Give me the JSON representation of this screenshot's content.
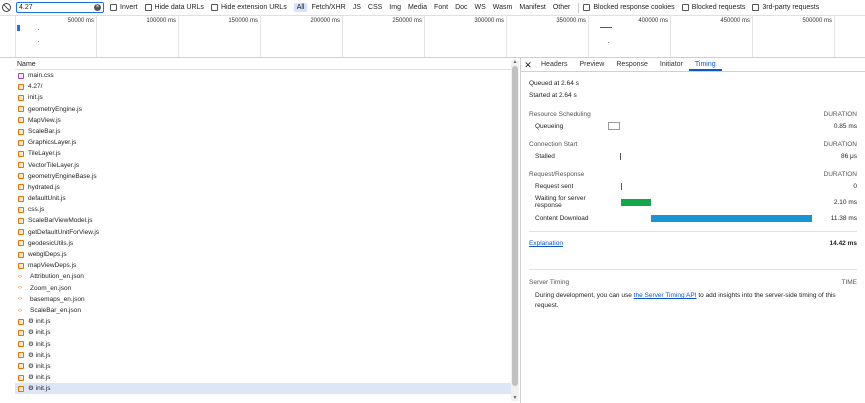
{
  "filter": {
    "value": "4.27",
    "invert_label": "Invert",
    "hide_data_urls_label": "Hide data URLs",
    "hide_extension_urls_label": "Hide extension URLs",
    "types": [
      "All",
      "Fetch/XHR",
      "JS",
      "CSS",
      "Img",
      "Media",
      "Font",
      "Doc",
      "WS",
      "Wasm",
      "Manifest",
      "Other"
    ],
    "blocked_cookies_label": "Blocked response cookies",
    "blocked_requests_label": "Blocked requests",
    "third_party_label": "3rd-party requests"
  },
  "overview": {
    "ticks": [
      "50000 ms",
      "100000 ms",
      "150000 ms",
      "200000 ms",
      "250000 ms",
      "300000 ms",
      "350000 ms",
      "400000 ms",
      "450000 ms",
      "500000 ms"
    ]
  },
  "list": {
    "header": "Name",
    "rows": [
      {
        "name": "main.css",
        "kind": "css"
      },
      {
        "name": "4.27/",
        "kind": "doc"
      },
      {
        "name": "init.js",
        "kind": "js"
      },
      {
        "name": "geometryEngine.js",
        "kind": "js"
      },
      {
        "name": "MapView.js",
        "kind": "js"
      },
      {
        "name": "ScaleBar.js",
        "kind": "js"
      },
      {
        "name": "GraphicsLayer.js",
        "kind": "js"
      },
      {
        "name": "TileLayer.js",
        "kind": "js"
      },
      {
        "name": "VectorTileLayer.js",
        "kind": "js"
      },
      {
        "name": "geometryEngineBase.js",
        "kind": "js"
      },
      {
        "name": "hydrated.js",
        "kind": "js"
      },
      {
        "name": "defaultUnit.js",
        "kind": "js"
      },
      {
        "name": "css.js",
        "kind": "js"
      },
      {
        "name": "ScaleBarViewModel.js",
        "kind": "js"
      },
      {
        "name": "getDefaultUnitForView.js",
        "kind": "js"
      },
      {
        "name": "geodesicUtils.js",
        "kind": "js"
      },
      {
        "name": "webglDeps.js",
        "kind": "js"
      },
      {
        "name": "mapViewDeps.js",
        "kind": "js"
      },
      {
        "name": "Attribution_en.json",
        "kind": "json"
      },
      {
        "name": "Zoom_en.json",
        "kind": "json"
      },
      {
        "name": "basemaps_en.json",
        "kind": "json"
      },
      {
        "name": "ScaleBar_en.json",
        "kind": "json"
      },
      {
        "name": "⚙ init.js",
        "kind": "js"
      },
      {
        "name": "⚙ init.js",
        "kind": "js"
      },
      {
        "name": "⚙ init.js",
        "kind": "js"
      },
      {
        "name": "⚙ init.js",
        "kind": "js"
      },
      {
        "name": "⚙ init.js",
        "kind": "js"
      },
      {
        "name": "⚙ init.js",
        "kind": "js"
      },
      {
        "name": "⚙ init.js",
        "kind": "js",
        "selected": true
      }
    ]
  },
  "panel": {
    "tabs": [
      "Headers",
      "Preview",
      "Response",
      "Initiator",
      "Timing"
    ],
    "active_tab": "Timing",
    "queued": "Queued at 2.64 s",
    "started": "Started at 2.64 s",
    "sections": [
      {
        "title": "Resource Scheduling",
        "col": "DURATION",
        "rows": [
          {
            "label": "Queueing",
            "dur": "0.85 ms",
            "type": "queue"
          }
        ]
      },
      {
        "title": "Connection Start",
        "col": "DURATION",
        "rows": [
          {
            "label": "Stalled",
            "dur": "86 μs",
            "type": "tick"
          }
        ]
      },
      {
        "title": "Request/Response",
        "col": "DURATION",
        "rows": [
          {
            "label": "Request sent",
            "dur": "0",
            "type": "tick"
          },
          {
            "label": "Waiting for server response",
            "dur": "2.10 ms",
            "type": "wait"
          },
          {
            "label": "Content Download",
            "dur": "11.38 ms",
            "type": "download"
          }
        ]
      }
    ],
    "explanation_label": "Explanation",
    "total": "14.42 ms",
    "server_timing_title": "Server Timing",
    "server_timing_col": "TIME",
    "server_text_before": "During development, you can use ",
    "server_link": "the Server Timing API",
    "server_text_after": " to add insights into the server-side timing of this request.",
    "colors": {
      "wait": "#12a84a",
      "download": "#1795d4",
      "accent": "#0b57d0"
    }
  }
}
